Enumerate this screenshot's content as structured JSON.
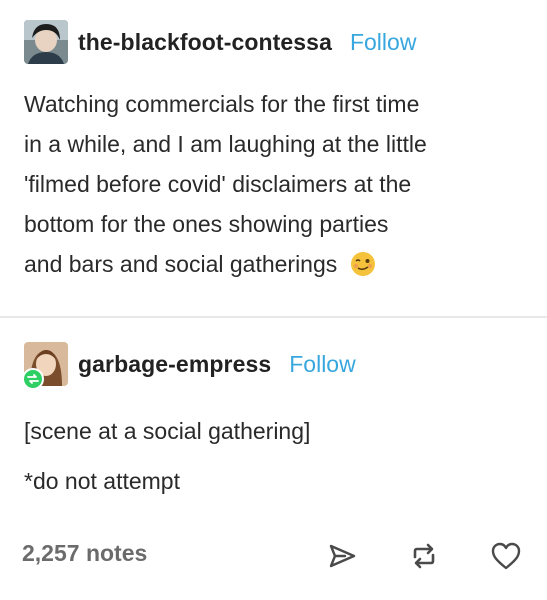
{
  "post1": {
    "username": "the-blackfoot-contessa",
    "follow_label": "Follow",
    "lines": [
      "Watching commercials for the first time",
      "in a while, and I am laughing at the little",
      "'filmed before covid' disclaimers at the",
      "bottom for the ones showing parties",
      "and bars and social gatherings"
    ],
    "emoji": "woozy-face"
  },
  "post2": {
    "username": "garbage-empress",
    "follow_label": "Follow",
    "lines": [
      "[scene at a social gathering]",
      "*do not attempt"
    ]
  },
  "footer": {
    "notes": "2,257 notes",
    "icons": [
      "share-icon",
      "reblog-icon",
      "heart-icon"
    ]
  },
  "colors": {
    "follow": "#38a7de",
    "notes": "#6b6b6b",
    "divider": "#e8e8e8"
  }
}
